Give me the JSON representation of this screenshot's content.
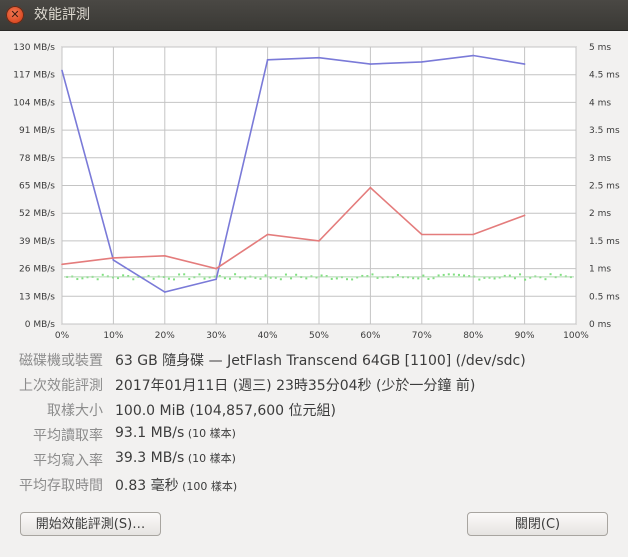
{
  "window": {
    "title": "效能評測",
    "close_glyph": "✕"
  },
  "chart_data": {
    "type": "line",
    "x": [
      0,
      10,
      20,
      30,
      40,
      50,
      60,
      70,
      80,
      90
    ],
    "x_tick_labels": [
      "0%",
      "10%",
      "20%",
      "30%",
      "40%",
      "50%",
      "60%",
      "70%",
      "80%",
      "90%",
      "100%"
    ],
    "y_left_tick_labels": [
      "0 MB/s",
      "13 MB/s",
      "26 MB/s",
      "39 MB/s",
      "52 MB/s",
      "65 MB/s",
      "78 MB/s",
      "91 MB/s",
      "104 MB/s",
      "117 MB/s",
      "130 MB/s"
    ],
    "y_right_tick_labels": [
      "0 ms",
      "0.5 ms",
      "1 ms",
      "1.5 ms",
      "2 ms",
      "2.5 ms",
      "3 ms",
      "3.5 ms",
      "4 ms",
      "4.5 ms",
      "5 ms"
    ],
    "xlim": [
      0,
      100
    ],
    "ylim_left": [
      0,
      130
    ],
    "ylim_right": [
      0,
      5
    ],
    "grid": true,
    "series": [
      {
        "axis": "left",
        "color": "#7a7ad8",
        "values": [
          119,
          30,
          15,
          21,
          124,
          125,
          122,
          123,
          126,
          122
        ]
      },
      {
        "axis": "left",
        "color": "#e47c7c",
        "values": [
          28,
          31,
          32,
          26,
          42,
          39,
          64,
          42,
          42,
          51
        ]
      },
      {
        "axis": "right",
        "color": "#80e080",
        "type": "scatter",
        "approx_level": 0.85,
        "spread": 0.1
      }
    ]
  },
  "details": [
    {
      "label": "磁碟機或裝置",
      "value": "63 GB 隨身碟 — JetFlash Transcend 64GB [1100] (/dev/sdc)",
      "note": ""
    },
    {
      "label": "上次效能評測",
      "value": "2017年01月11日 (週三) 23時35分04秒 (少於一分鐘 前)",
      "note": ""
    },
    {
      "label": "取樣大小",
      "value": "100.0 MiB (104,857,600 位元組)",
      "note": ""
    },
    {
      "label": "平均讀取率",
      "value": "93.1 MB/s",
      "note": "(10 樣本)"
    },
    {
      "label": "平均寫入率",
      "value": "39.3 MB/s",
      "note": "(10 樣本)"
    },
    {
      "label": "平均存取時間",
      "value": "0.83 毫秒",
      "note": "(100 樣本)"
    }
  ],
  "buttons": {
    "start": "開始效能評測(S)…",
    "close": "關閉(C)"
  }
}
